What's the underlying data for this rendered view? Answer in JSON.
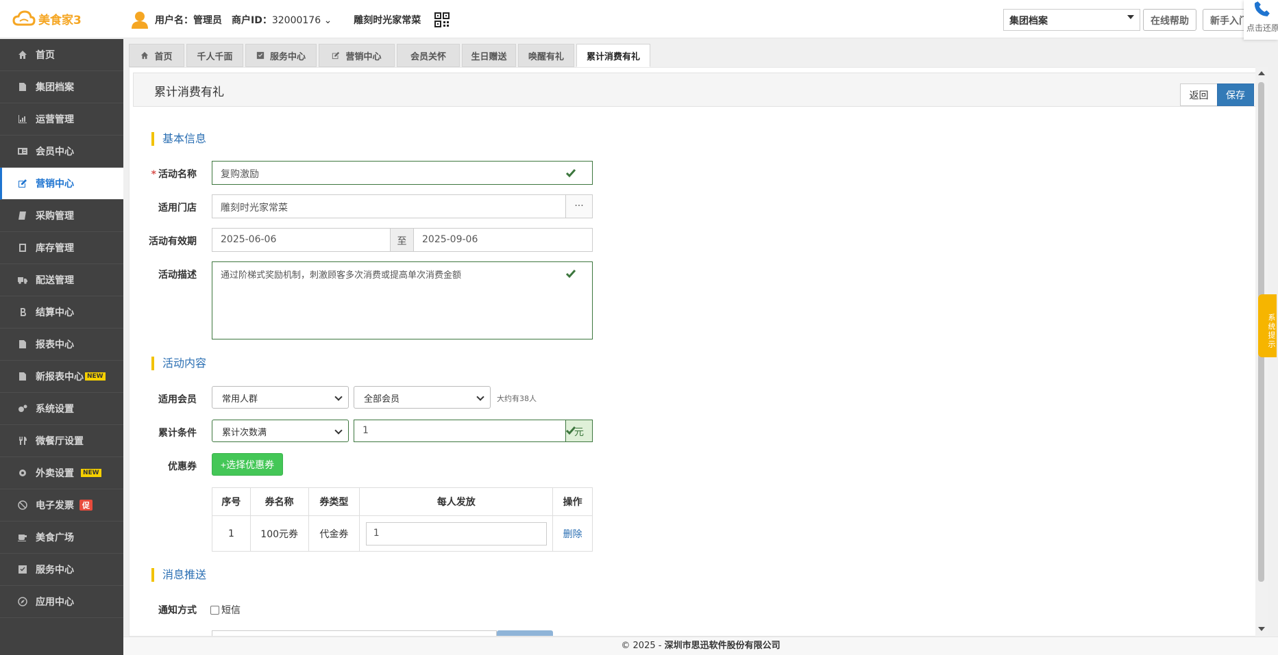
{
  "header": {
    "logo_text": "美食家3",
    "user_label": "用户名：",
    "user_name": "管理员",
    "merchant_label": "商户ID：",
    "merchant_id": "32000176",
    "store_name": "雕刻时光家常菜",
    "group_select": "集团档案",
    "help_btn": "在线帮助",
    "newbie_btn": "新手入门",
    "phone_text": "点击还原"
  },
  "sidebar": {
    "items": [
      {
        "label": "首页",
        "icon": "home-icon"
      },
      {
        "label": "集团档案",
        "icon": "document-icon"
      },
      {
        "label": "运营管理",
        "icon": "bar-chart-icon"
      },
      {
        "label": "会员中心",
        "icon": "id-card-icon"
      },
      {
        "label": "营销中心",
        "icon": "edit-icon"
      },
      {
        "label": "采购管理",
        "icon": "book-icon"
      },
      {
        "label": "库存管理",
        "icon": "document-icon"
      },
      {
        "label": "配送管理",
        "icon": "truck-icon"
      },
      {
        "label": "结算中心",
        "icon": "bitcoin-icon"
      },
      {
        "label": "报表中心",
        "icon": "report-icon"
      },
      {
        "label": "新报表中心",
        "icon": "report-icon",
        "badge": "NEW"
      },
      {
        "label": "系统设置",
        "icon": "gears-icon"
      },
      {
        "label": "微餐厅设置",
        "icon": "cutlery-icon"
      },
      {
        "label": "外卖设置",
        "icon": "gear-icon",
        "badge": "NEW"
      },
      {
        "label": "电子发票",
        "icon": "ban-icon",
        "badge": "促"
      },
      {
        "label": "美食广场",
        "icon": "coffee-icon"
      },
      {
        "label": "服务中心",
        "icon": "check-square-icon"
      },
      {
        "label": "应用中心",
        "icon": "compass-icon"
      }
    ]
  },
  "tabs": [
    {
      "label": "首页",
      "icon": "home-icon"
    },
    {
      "label": "千人千面"
    },
    {
      "label": "服务中心",
      "icon": "check-square-icon"
    },
    {
      "label": "营销中心",
      "icon": "edit-icon"
    },
    {
      "label": "会员关怀"
    },
    {
      "label": "生日赠送"
    },
    {
      "label": "唤醒有礼"
    },
    {
      "label": "累计消费有礼"
    }
  ],
  "page": {
    "title": "累计消费有礼",
    "back_btn": "返回",
    "save_btn": "保存"
  },
  "basic": {
    "section": "基本信息",
    "name_label": "活动名称",
    "name_value": "复购激励",
    "store_label": "适用门店",
    "store_value": "雕刻时光家常菜",
    "store_more": "···",
    "period_label": "活动有效期",
    "start_date": "2025-06-06",
    "to": "至",
    "end_date": "2025-09-06",
    "desc_label": "活动描述",
    "desc_value": "通过阶梯式奖励机制，刺激顾客多次消费或提高单次消费金额"
  },
  "content": {
    "section": "活动内容",
    "member_label": "适用会员",
    "member_group": "常用人群",
    "member_type": "全部会员",
    "member_count": "大约有38人",
    "cond_label": "累计条件",
    "cond_type": "累计次数满",
    "cond_value": "1",
    "cond_unit": "元",
    "coupon_label": "优惠券",
    "coupon_btn": "+选择优惠券",
    "table": {
      "headers": [
        "序号",
        "券名称",
        "券类型",
        "每人发放",
        "操作"
      ],
      "rows": [
        {
          "no": "1",
          "name": "100元券",
          "type": "代金券",
          "qty": "1",
          "action": "删除"
        }
      ]
    }
  },
  "message": {
    "section": "消息推送",
    "notify_label": "通知方式",
    "sms": "短信"
  },
  "sys_tip": "系统提示",
  "footer": {
    "prefix": "© 2025 - ",
    "company": "深圳市思迅软件股份有限公司"
  }
}
